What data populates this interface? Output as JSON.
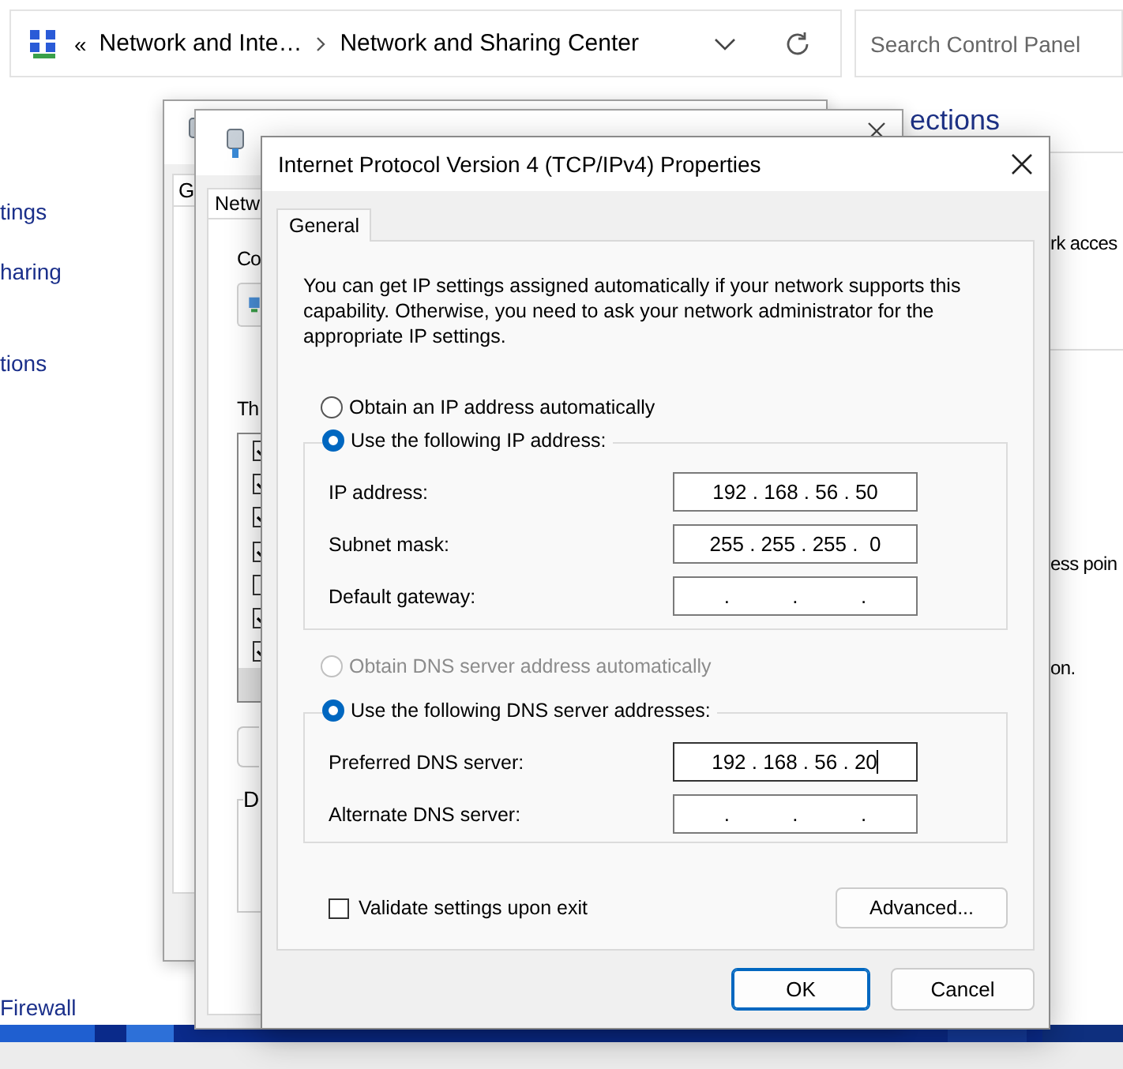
{
  "explorer": {
    "overflow_glyph": "«",
    "breadcrumb": [
      {
        "text": "Network and Inte…"
      },
      {
        "text": "Network and Sharing Center"
      }
    ],
    "search": {
      "placeholder": "Search Control Panel"
    },
    "nav_items": [
      {
        "text": "tings"
      },
      {
        "text": "haring"
      },
      {
        "text": "tions"
      },
      {
        "text": "Firewall"
      }
    ],
    "heading": "ections",
    "content_lines": [
      {
        "text": "rk acces"
      },
      {
        "text": "ess poin"
      },
      {
        "text": "on."
      }
    ]
  },
  "back_windows": [
    {
      "tab": "G"
    },
    {
      "tab": "Netw",
      "section_label": "Co",
      "list_label": "Th",
      "group_label": "D",
      "components": [
        {
          "checked": true
        },
        {
          "checked": true
        },
        {
          "checked": true
        },
        {
          "checked": true
        },
        {
          "checked": false
        },
        {
          "checked": true
        },
        {
          "checked": true
        }
      ]
    }
  ],
  "dialog": {
    "title": "Internet Protocol Version 4 (TCP/IPv4) Properties",
    "tabs": [
      {
        "label": "General",
        "selected": true
      }
    ],
    "description": "You can get IP settings assigned automatically if your network supports this capability. Otherwise, you need to ask your network administrator for the appropriate IP settings.",
    "ip_options": [
      {
        "label": "Obtain an IP address automatically",
        "selected": false,
        "disabled": false
      },
      {
        "label": "Use the following IP address:",
        "selected": true,
        "disabled": false
      }
    ],
    "ip_fields": [
      {
        "label": "IP address:",
        "value": "192 . 168 . 56 . 50",
        "focused": false
      },
      {
        "label": "Subnet mask:",
        "value": "255 . 255 . 255 .  0",
        "focused": false
      },
      {
        "label": "Default gateway:",
        "value": ".           .           .",
        "focused": false
      }
    ],
    "dns_options": [
      {
        "label": "Obtain DNS server address automatically",
        "selected": false,
        "disabled": true
      },
      {
        "label": "Use the following DNS server addresses:",
        "selected": true,
        "disabled": false
      }
    ],
    "dns_fields": [
      {
        "label": "Preferred DNS server:",
        "value": "192 . 168 . 56 . 20",
        "focused": true
      },
      {
        "label": "Alternate DNS server:",
        "value": ".           .           .",
        "focused": false
      }
    ],
    "validate": {
      "label": "Validate settings upon exit",
      "checked": false
    },
    "advanced_button": "Advanced...",
    "buttons": [
      {
        "label": "OK",
        "default": true
      },
      {
        "label": "Cancel",
        "default": false
      }
    ]
  }
}
